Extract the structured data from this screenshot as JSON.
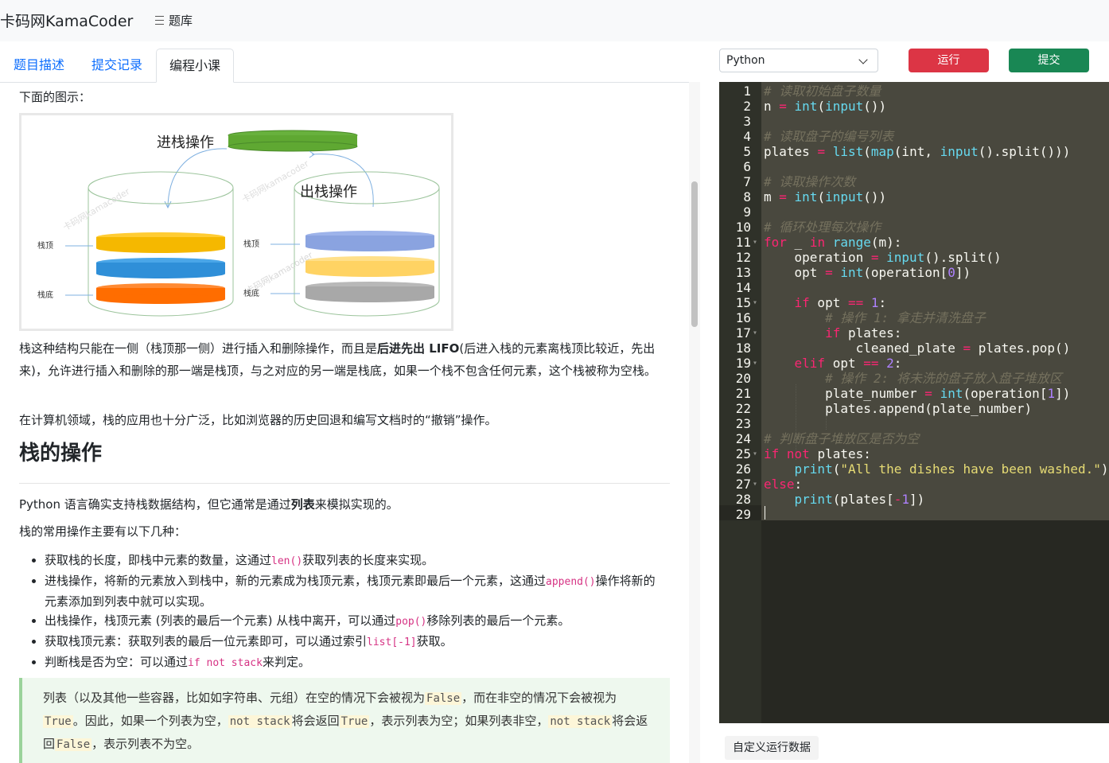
{
  "header": {
    "brand": "卡码网KamaCoder",
    "nav_label": "题库"
  },
  "tabs": [
    {
      "label": "题目描述"
    },
    {
      "label": "提交记录"
    },
    {
      "label": "编程小课"
    }
  ],
  "content": {
    "fig_caption": "下面的图示：",
    "figure": {
      "push_label": "进栈操作",
      "pop_label": "出栈操作",
      "top_label": "栈顶",
      "bottom_label": "栈底",
      "watermark": "卡码网kamacoder"
    },
    "para1_a": "栈这种结构只能在一侧（栈顶那一侧）进行插入和删除操作，而且是",
    "para1_bold": "后进先出 LIFO",
    "para1_b": "(后进入栈的元素离栈顶比较近，先出来)，允许进行插入和删除的那一端是栈顶，与之对应的另一端是栈底，如果一个栈不包含任何元素，这个栈被称为空栈。",
    "para2": "在计算机领域，栈的应用也十分广泛，比如浏览器的历史回退和编写文档时的“撤销”操作。",
    "section_title": "栈的操作",
    "para3_a": "Python 语言确实支持栈数据结构，但它通常是通过",
    "para3_bold": "列表",
    "para3_b": "来模拟实现的。",
    "para4": "栈的常用操作主要有以下几种：",
    "ops": [
      {
        "a": "获取栈的长度，即栈中元素的数量，这通过",
        "code": "len()",
        "b": "获取列表的长度来实现。"
      },
      {
        "a": "进栈操作，将新的元素放入到栈中，新的元素成为栈顶元素，栈顶元素即最后一个元素，这通过",
        "code": "append()",
        "b": "操作将新的元素添加到列表中就可以实现。"
      },
      {
        "a": "出栈操作，栈顶元素 (列表的最后一个元素) 从栈中离开，可以通过",
        "code": "pop()",
        "b": "移除列表的最后一个元素。"
      },
      {
        "a": "获取栈顶元素：获取列表的最后一位元素即可，可以通过索引",
        "code": "list[-1]",
        "b": "获取。"
      },
      {
        "a": "判断栈是否为空：可以通过",
        "code": "if not stack",
        "b": "来判定。"
      }
    ],
    "quote": {
      "t1": "列表（以及其他一些容器，比如如字符串、元组）在空的情况下会被视为",
      "c1": "False",
      "t2": "，而在非空的情况下会被视为",
      "c2": "True",
      "t3": "。因此，如果一个列表为空，",
      "c3": "not stack",
      "t4": "将会返回",
      "c4": "True",
      "t5": "，表示列表为空；如果列表非空，",
      "c5": "not stack",
      "t6": "将会返回",
      "c6": "False",
      "t7": "，表示列表不为空。"
    }
  },
  "toolbar": {
    "language": "Python",
    "run_label": "运行",
    "submit_label": "提交"
  },
  "editor": {
    "lines": [
      "# 读取初始盘子数量",
      "n = int(input())",
      "",
      "# 读取盘子的编号列表",
      "plates = list(map(int, input().split()))",
      "",
      "# 读取操作次数",
      "m = int(input())",
      "",
      "# 循环处理每次操作",
      "for _ in range(m):",
      "    operation = input().split()",
      "    opt = int(operation[0])",
      "",
      "    if opt == 1:",
      "        # 操作 1: 拿走并清洗盘子",
      "        if plates:",
      "            cleaned_plate = plates.pop()",
      "    elif opt == 2:",
      "        # 操作 2: 将未洗的盘子放入盘子堆放区",
      "        plate_number = int(operation[1])",
      "        plates.append(plate_number)",
      "",
      "# 判断盘子堆放区是否为空",
      "if not plates:",
      "    print(\"All the dishes have been washed.\")",
      "else:",
      "    print(plates[-1])",
      ""
    ]
  },
  "custom_run_label": "自定义运行数据"
}
